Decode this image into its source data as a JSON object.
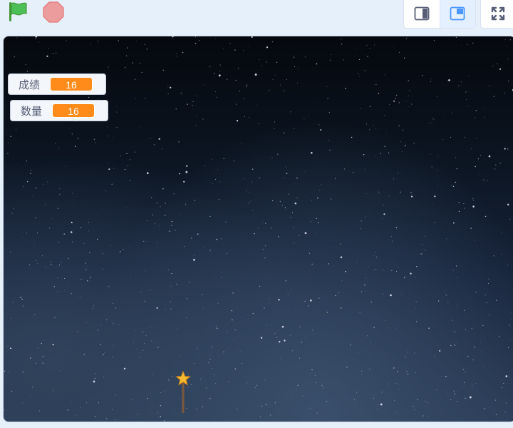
{
  "toolbar": {
    "green_flag_icon": "green-flag-icon",
    "stop_icon": "stop-sign-icon",
    "small_stage_icon": "small-stage-layout-icon",
    "normal_stage_icon": "normal-stage-layout-icon",
    "fullscreen_icon": "fullscreen-icon",
    "selected_layout": "normal"
  },
  "monitors": [
    {
      "label": "成绩",
      "value": "16"
    },
    {
      "label": "数量",
      "value": "16"
    }
  ],
  "stage": {
    "backdrop": "starry-night-sky",
    "sprite": "star-wand"
  },
  "colors": {
    "monitor_value_bg": "#ff8c1a",
    "flag_green": "#4cbf56",
    "stop_red": "#ec9c9c",
    "accent_blue": "#4c97ff"
  }
}
